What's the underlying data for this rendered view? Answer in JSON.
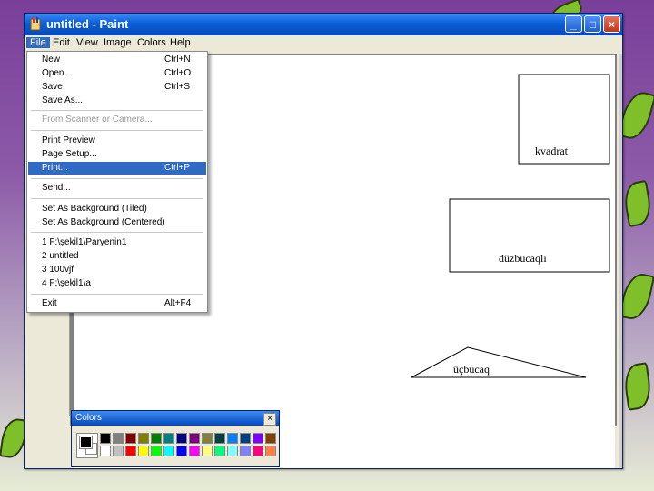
{
  "window": {
    "title": "untitled - Paint"
  },
  "title_buttons": {
    "minimize": "_",
    "maximize": "□",
    "close": "×"
  },
  "menubar": [
    "File",
    "Edit",
    "View",
    "Image",
    "Colors",
    "Help"
  ],
  "file_menu": {
    "items": [
      {
        "label": "New",
        "shortcut": "Ctrl+N"
      },
      {
        "label": "Open...",
        "shortcut": "Ctrl+O"
      },
      {
        "label": "Save",
        "shortcut": "Ctrl+S"
      },
      {
        "label": "Save As...",
        "shortcut": ""
      },
      {
        "label": "From Scanner or Camera...",
        "shortcut": ""
      },
      {
        "label": "Print Preview",
        "shortcut": ""
      },
      {
        "label": "Page Setup...",
        "shortcut": ""
      },
      {
        "label": "Print...",
        "shortcut": "Ctrl+P"
      },
      {
        "label": "Send...",
        "shortcut": ""
      },
      {
        "label": "Set As Background (Tiled)",
        "shortcut": ""
      },
      {
        "label": "Set As Background (Centered)",
        "shortcut": ""
      },
      {
        "label": "1 F:\\şekil1\\Paryenin1",
        "shortcut": ""
      },
      {
        "label": "2 untitled",
        "shortcut": ""
      },
      {
        "label": "3 100vjf",
        "shortcut": ""
      },
      {
        "label": "4 F:\\şekil1\\a",
        "shortcut": ""
      },
      {
        "label": "Exit",
        "shortcut": "Alt+F4"
      }
    ]
  },
  "canvas": {
    "shape_labels": {
      "square": "kvadrat",
      "rectangle": "düzbucaqlı",
      "triangle": "üçbucaq"
    }
  },
  "colors_panel": {
    "title": "Colors",
    "foreground": "#000000",
    "background": "#ffffff",
    "palette_top": [
      "#000000",
      "#808080",
      "#800000",
      "#808000",
      "#008000",
      "#008080",
      "#000080",
      "#800080",
      "#808040",
      "#004040",
      "#0080ff",
      "#004080",
      "#8000ff",
      "#804000"
    ],
    "palette_bottom": [
      "#ffffff",
      "#c0c0c0",
      "#ff0000",
      "#ffff00",
      "#00ff00",
      "#00ffff",
      "#0000ff",
      "#ff00ff",
      "#ffff80",
      "#00ff80",
      "#80ffff",
      "#8080ff",
      "#ff0080",
      "#ff8040"
    ]
  }
}
